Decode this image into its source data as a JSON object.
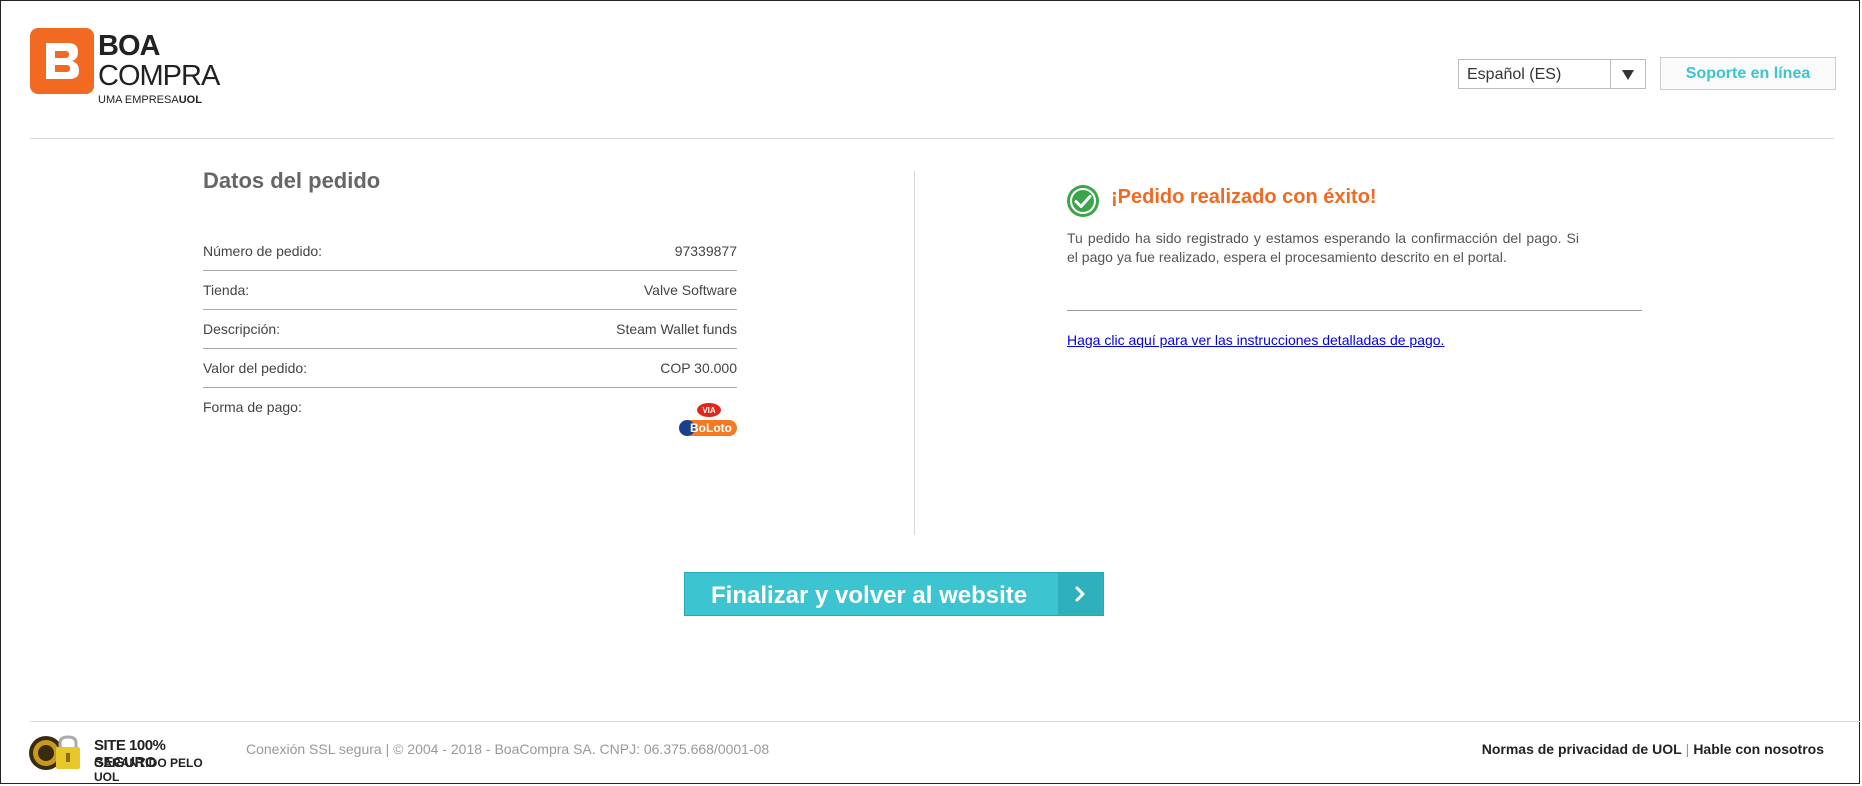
{
  "header": {
    "logo_line1": "BOA",
    "logo_line2": "COMPRA",
    "logo_tagline_prefix": "UMA EMPRESA",
    "logo_tagline_brand": "UOL",
    "language_selected": "Español (ES)",
    "support_label": "Soporte en línea"
  },
  "order": {
    "title": "Datos del pedido",
    "rows": [
      {
        "label": "Número de pedido:",
        "value": "97339877"
      },
      {
        "label": "Tienda:",
        "value": "Valve Software"
      },
      {
        "label": "Descripción:",
        "value": "Steam Wallet funds"
      },
      {
        "label": "Valor del pedido:",
        "value": "COP 30.000"
      },
      {
        "label": "Forma de pago:",
        "value": ""
      }
    ],
    "payment_logo_top": "VIA",
    "payment_logo_bottom": "BoLoto"
  },
  "status": {
    "title": "¡Pedido realizado con éxito!",
    "message": "Tu pedido ha sido registrado y estamos esperando la confirmacción del pago. Si el pago ya fue realizado, espera el procesamiento descrito en el portal.",
    "instructions_link": "Haga clic aquí para ver las instrucciones detalladas de pago."
  },
  "actions": {
    "finish_label": "Finalizar y volver al website"
  },
  "footer": {
    "seal_line1": "SITE 100% SEGURO",
    "seal_line2_prefix": "GARANTIDO PELO",
    "seal_line2_brand": "UOL",
    "copyright": "Conexión SSL segura | © 2004 - 2018 - BoaCompra SA. CNPJ: 06.375.668/0001-08",
    "privacy_link": "Normas de privacidad de UOL",
    "contact_link": "Hable con nosotros"
  },
  "colors": {
    "brand_orange": "#f26a21",
    "accent_teal": "#3cc4d0",
    "success_green": "#3aa54a"
  }
}
